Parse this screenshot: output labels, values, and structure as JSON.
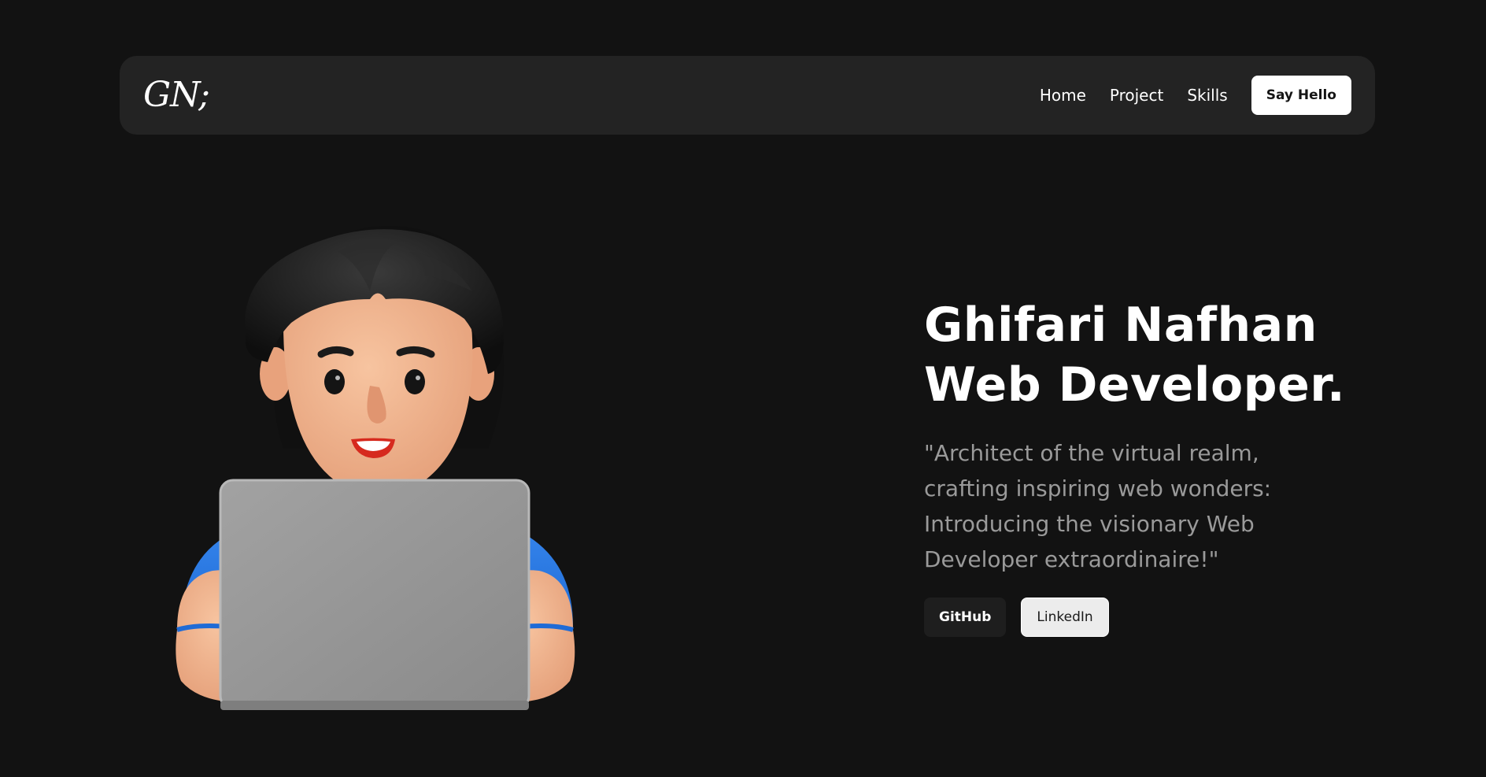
{
  "navbar": {
    "logo": "GN;",
    "links": [
      "Home",
      "Project",
      "Skills"
    ],
    "cta_label": "Say Hello"
  },
  "hero": {
    "title_line1": "Ghifari Nafhan",
    "title_line2": "Web Developer.",
    "quote": "\"Architect of the virtual realm, crafting inspiring web wonders: Introducing the visionary Web Developer extraordinaire!\"",
    "buttons": {
      "github": "GitHub",
      "linkedin": "LinkedIn"
    }
  },
  "colors": {
    "background": "#121212",
    "navbar": "#232323",
    "shirt": "#2b7be4",
    "laptop": "#9a9a9a",
    "skin": "#f2b38d",
    "hair": "#161616"
  },
  "icons": {
    "avatar": "3d-developer-with-laptop-illustration"
  }
}
